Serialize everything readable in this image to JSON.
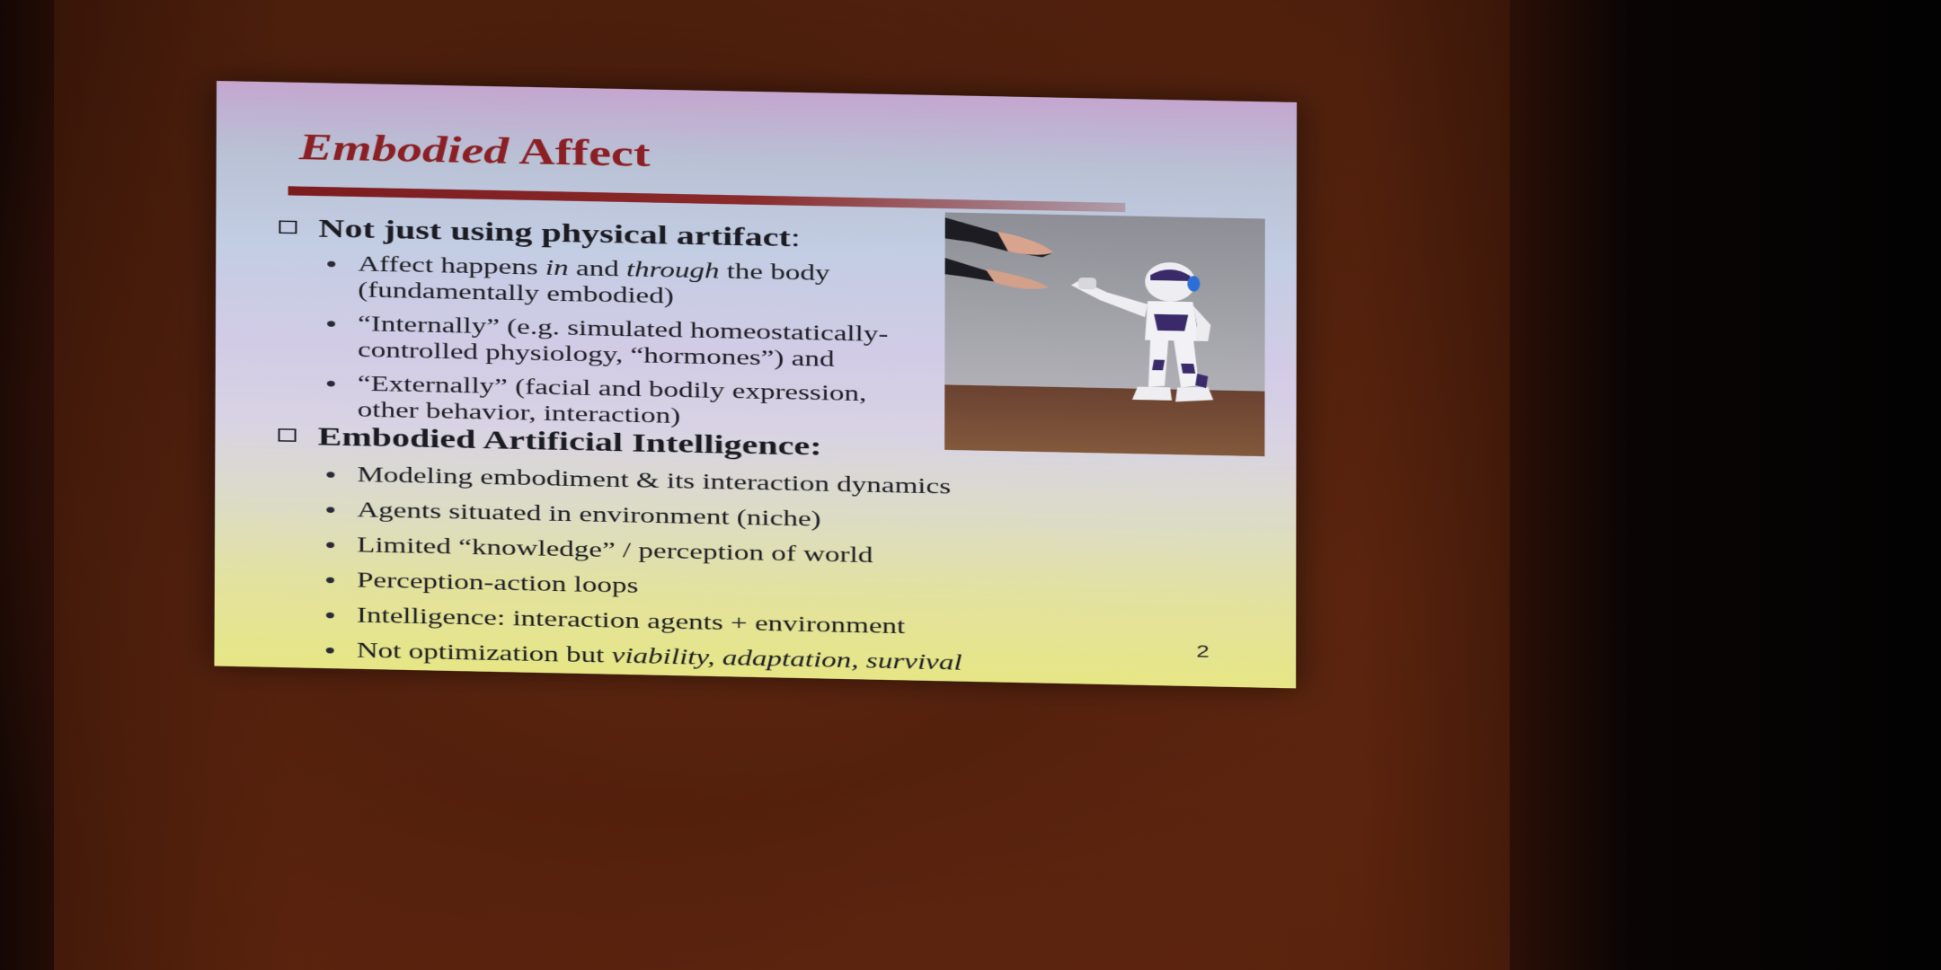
{
  "slide": {
    "title_em": "Embodied",
    "title_rest": "Affect",
    "page_number": "2",
    "sections": [
      {
        "heading": "Not just using physical artifact",
        "heading_suffix": ":",
        "bullets": [
          [
            {
              "t": "Affect happens "
            },
            {
              "t": "in",
              "i": true
            },
            {
              "t": " and "
            },
            {
              "t": "through",
              "i": true
            },
            {
              "t": " the body (fundamentally embodied)"
            }
          ],
          [
            {
              "t": "“Internally” (e.g. simulated homeostatically-controlled physiology, “hormones”) and"
            }
          ],
          [
            {
              "t": "“Externally” (facial and bodily expression, other behavior, interaction)"
            }
          ]
        ]
      },
      {
        "heading": "Embodied Artificial Intelligence:",
        "heading_suffix": "",
        "bullets": [
          [
            {
              "t": "Modeling embodiment & its interaction dynamics"
            }
          ],
          [
            {
              "t": "Agents situated in environment (niche)"
            }
          ],
          [
            {
              "t": "Limited “knowledge” / perception of world"
            }
          ],
          [
            {
              "t": "Perception-action loops"
            }
          ],
          [
            {
              "t": "Intelligence: interaction agents + environment"
            }
          ],
          [
            {
              "t": "Not optimization but "
            },
            {
              "t": "viability, adaptation, survival",
              "i": true
            }
          ]
        ]
      }
    ]
  },
  "photo": {
    "subject": "humanoid robot facing outstretched human hands",
    "colors": {
      "robot_white": "#f2f2f6",
      "robot_accent": "#3a2a6a",
      "floor": "#6e4630",
      "wall": "#9c9ca4"
    }
  },
  "colors": {
    "title": "#8a1f24",
    "text": "#1b1b22",
    "slide_top": "#c4a6cf",
    "slide_bottom": "#e6e686",
    "room": "#5a2410"
  }
}
